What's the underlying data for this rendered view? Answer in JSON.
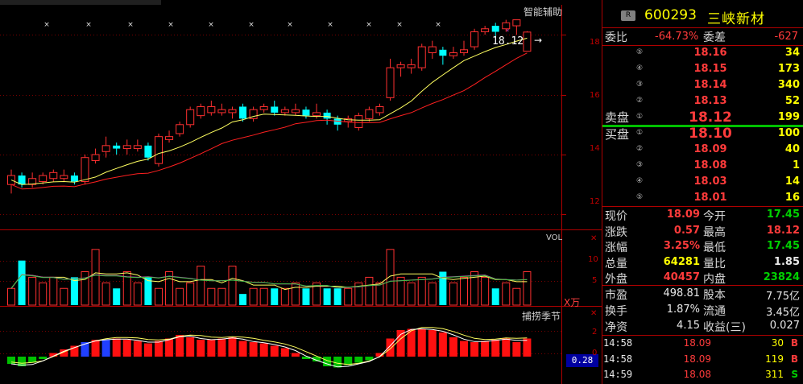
{
  "indicators": {
    "main": "智能辅助",
    "price_marker": "18.12",
    "vol": "VOL",
    "unit": "X万",
    "sub": "捕捞季节",
    "sub_value": "0.28"
  },
  "axes": {
    "price_ticks": [
      "18",
      "16",
      "14",
      "12"
    ],
    "vol_ticks": [
      "10",
      "5"
    ],
    "sub_ticks": [
      "2",
      "0"
    ]
  },
  "stock": {
    "badge": "R",
    "code": "600293",
    "name": "三峡新材"
  },
  "order_ratio": {
    "wb_label": "委比",
    "wb_value": "-64.73%",
    "wc_label": "委差",
    "wc_value": "-627"
  },
  "sell": [
    {
      "idx": "⑤",
      "price": "18.16",
      "vol": "34"
    },
    {
      "idx": "④",
      "price": "18.15",
      "vol": "173"
    },
    {
      "idx": "③",
      "price": "18.14",
      "vol": "340"
    },
    {
      "idx": "②",
      "price": "18.13",
      "vol": "52"
    },
    {
      "idx": "①",
      "price": "18.12",
      "vol": "199"
    }
  ],
  "buy": [
    {
      "idx": "①",
      "price": "18.10",
      "vol": "100"
    },
    {
      "idx": "②",
      "price": "18.09",
      "vol": "40"
    },
    {
      "idx": "③",
      "price": "18.08",
      "vol": "1"
    },
    {
      "idx": "④",
      "price": "18.03",
      "vol": "14"
    },
    {
      "idx": "⑤",
      "price": "18.01",
      "vol": "16"
    }
  ],
  "sell_label": "卖盘",
  "buy_label": "买盘",
  "quote": [
    {
      "l1": "现价",
      "v1": "18.09",
      "l2": "今开",
      "v2": "17.45"
    },
    {
      "l1": "涨跌",
      "v1": "0.57",
      "l2": "最高",
      "v2": "18.12"
    },
    {
      "l1": "涨幅",
      "v1": "3.25%",
      "l2": "最低",
      "v2": "17.45"
    },
    {
      "l1": "总量",
      "v1": "64281",
      "l2": "量比",
      "v2": "1.85"
    },
    {
      "l1": "外盘",
      "v1": "40457",
      "l2": "内盘",
      "v2": "23824"
    }
  ],
  "fundamentals": [
    {
      "l1": "市盈",
      "v1": "498.81",
      "l2": "股本",
      "v2": "7.75亿"
    },
    {
      "l1": "换手",
      "v1": "1.87%",
      "l2": "流通",
      "v2": "3.45亿"
    },
    {
      "l1": "净资",
      "v1": "4.15",
      "l2": "收益(三)",
      "v2": "0.027"
    }
  ],
  "ticks": [
    {
      "time": "14:58",
      "price": "18.09",
      "vol": "30",
      "side": "B"
    },
    {
      "time": "14:58",
      "price": "18.09",
      "vol": "119",
      "side": "B"
    },
    {
      "time": "14:59",
      "price": "18.08",
      "vol": "311",
      "side": "S"
    }
  ],
  "chart_data": {
    "type": "candlestick",
    "price_ylim": [
      11.5,
      19.0
    ],
    "candles": [
      [
        13.0,
        13.3,
        12.7,
        13.5,
        "up"
      ],
      [
        13.3,
        13.0,
        12.9,
        13.4,
        "dn"
      ],
      [
        13.0,
        13.2,
        12.9,
        13.4,
        "up"
      ],
      [
        13.1,
        13.3,
        13.0,
        13.4,
        "up"
      ],
      [
        13.2,
        13.4,
        13.1,
        13.5,
        "up"
      ],
      [
        13.2,
        13.3,
        13.1,
        13.5,
        "up"
      ],
      [
        13.3,
        13.1,
        13.0,
        13.4,
        "dn"
      ],
      [
        13.1,
        13.9,
        13.0,
        14.0,
        "up"
      ],
      [
        13.8,
        14.0,
        13.7,
        14.2,
        "up"
      ],
      [
        14.1,
        14.3,
        13.9,
        14.6,
        "up"
      ],
      [
        14.3,
        14.2,
        14.0,
        14.4,
        "dn"
      ],
      [
        14.2,
        14.3,
        14.0,
        14.5,
        "up"
      ],
      [
        14.2,
        14.3,
        14.1,
        14.5,
        "up"
      ],
      [
        14.3,
        13.9,
        13.8,
        14.4,
        "dn"
      ],
      [
        13.7,
        14.6,
        13.6,
        14.7,
        "up"
      ],
      [
        14.5,
        14.6,
        14.4,
        14.8,
        "up"
      ],
      [
        14.7,
        15.0,
        14.6,
        15.1,
        "up"
      ],
      [
        15.0,
        15.5,
        14.9,
        15.6,
        "up"
      ],
      [
        15.3,
        15.6,
        15.2,
        15.7,
        "up"
      ],
      [
        15.4,
        15.6,
        15.3,
        15.8,
        "up"
      ],
      [
        15.4,
        15.5,
        15.3,
        15.7,
        "up"
      ],
      [
        15.4,
        15.5,
        15.2,
        15.6,
        "up"
      ],
      [
        15.6,
        15.2,
        15.1,
        15.7,
        "dn"
      ],
      [
        15.2,
        15.5,
        15.1,
        15.6,
        "up"
      ],
      [
        15.5,
        15.6,
        15.4,
        15.7,
        "up"
      ],
      [
        15.6,
        15.4,
        15.3,
        15.8,
        "dn"
      ],
      [
        15.4,
        15.5,
        15.3,
        15.6,
        "up"
      ],
      [
        15.4,
        15.5,
        15.3,
        15.7,
        "up"
      ],
      [
        15.5,
        15.3,
        15.2,
        15.6,
        "dn"
      ],
      [
        15.3,
        15.4,
        15.2,
        15.7,
        "up"
      ],
      [
        15.4,
        15.2,
        15.0,
        15.5,
        "dn"
      ],
      [
        15.2,
        15.0,
        14.8,
        15.3,
        "dn"
      ],
      [
        15.1,
        15.2,
        14.9,
        15.3,
        "up"
      ],
      [
        14.9,
        15.3,
        14.8,
        15.4,
        "up"
      ],
      [
        15.2,
        15.5,
        15.1,
        15.6,
        "up"
      ],
      [
        15.4,
        15.6,
        15.3,
        15.7,
        "up"
      ],
      [
        15.9,
        16.9,
        15.8,
        17.2,
        "up"
      ],
      [
        16.9,
        17.0,
        16.6,
        17.1,
        "up"
      ],
      [
        16.9,
        17.0,
        16.7,
        17.2,
        "up"
      ],
      [
        16.9,
        17.6,
        16.8,
        17.7,
        "up"
      ],
      [
        17.4,
        17.6,
        17.2,
        17.8,
        "up"
      ],
      [
        17.5,
        17.3,
        17.0,
        17.6,
        "dn"
      ],
      [
        17.3,
        17.4,
        17.2,
        17.6,
        "up"
      ],
      [
        17.4,
        17.5,
        17.3,
        17.8,
        "up"
      ],
      [
        17.6,
        18.1,
        17.5,
        18.2,
        "up"
      ],
      [
        18.1,
        18.2,
        18.0,
        18.3,
        "up"
      ],
      [
        18.3,
        18.1,
        17.9,
        18.4,
        "dn"
      ],
      [
        18.2,
        18.4,
        18.1,
        18.5,
        "up"
      ],
      [
        18.3,
        18.5,
        18.0,
        18.5,
        "up"
      ],
      [
        17.45,
        18.09,
        17.45,
        18.12,
        "up"
      ]
    ],
    "volume": [
      3,
      8,
      5,
      4,
      5,
      3,
      5,
      6,
      10,
      4,
      3,
      6,
      4,
      5,
      3,
      6,
      3,
      4,
      7,
      3,
      3,
      7,
      2,
      3,
      3,
      3,
      3,
      4,
      3,
      4,
      3,
      3,
      3,
      4,
      5,
      4,
      10,
      5,
      4,
      5,
      4,
      6,
      4,
      5,
      6,
      5,
      3,
      4,
      3,
      6
    ],
    "sub_values": [
      -0.6,
      -0.8,
      -0.5,
      -0.2,
      0.3,
      0.6,
      0.9,
      1.2,
      1.4,
      1.4,
      1.5,
      1.4,
      1.3,
      1.1,
      1.3,
      1.5,
      1.8,
      1.6,
      1.4,
      1.4,
      1.5,
      1.6,
      1.3,
      1.2,
      1.1,
      0.9,
      0.7,
      0.3,
      -0.2,
      -0.4,
      -0.8,
      -0.9,
      -0.7,
      -0.5,
      -0.3,
      0.3,
      1.5,
      2.2,
      2.3,
      2.3,
      2.2,
      2.0,
      1.6,
      1.3,
      1.2,
      1.3,
      1.4,
      1.5,
      1.2,
      1.5
    ]
  }
}
